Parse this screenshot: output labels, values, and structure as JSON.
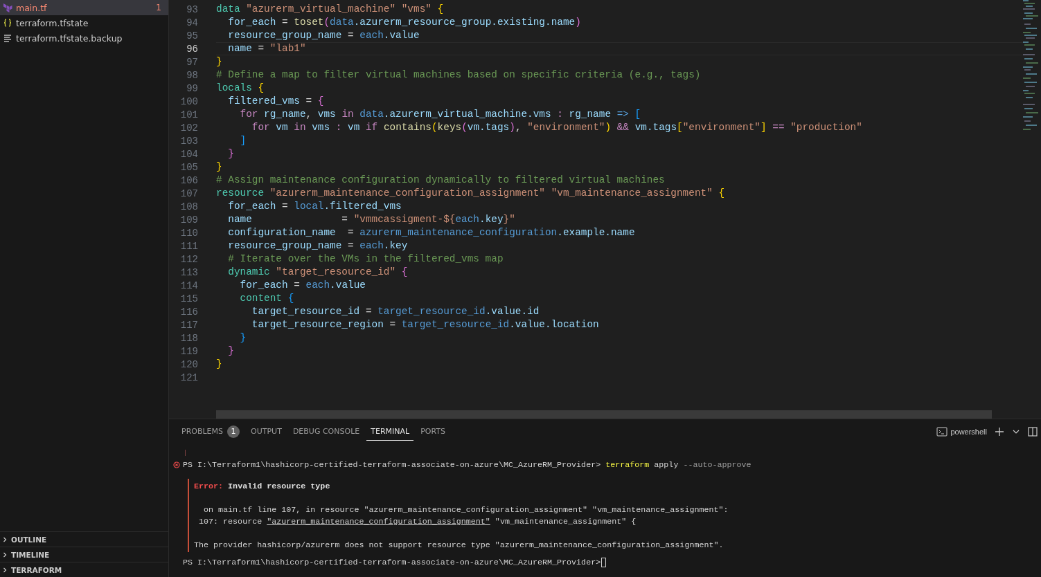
{
  "explorer": {
    "files": [
      {
        "name": "main.tf",
        "kind": "terraform",
        "selected": true,
        "error": true,
        "problems": "1"
      },
      {
        "name": "terraform.tfstate",
        "kind": "json",
        "selected": false,
        "error": false
      },
      {
        "name": "terraform.tfstate.backup",
        "kind": "text",
        "selected": false,
        "error": false
      }
    ],
    "sections": [
      {
        "title": "OUTLINE"
      },
      {
        "title": "TIMELINE"
      },
      {
        "title": "TERRAFORM"
      }
    ]
  },
  "editor": {
    "lines": [
      {
        "number": "93",
        "current": false,
        "tokens": [
          {
            "kind": "kw",
            "text": "data "
          },
          {
            "kind": "str",
            "text": "\"azurerm_virtual_machine\" "
          },
          {
            "kind": "str",
            "text": "\"vms\" "
          },
          {
            "kind": "b1",
            "text": "{"
          }
        ]
      },
      {
        "number": "94",
        "current": false,
        "tokens": [
          {
            "kind": "prop",
            "text": "  for_each"
          },
          {
            "kind": "p",
            "text": " = "
          },
          {
            "kind": "fn",
            "text": "toset"
          },
          {
            "kind": "b2",
            "text": "("
          },
          {
            "kind": "var",
            "text": "data"
          },
          {
            "kind": "prop",
            "text": ".azurerm_resource_group.existing.name"
          },
          {
            "kind": "b2",
            "text": ")"
          }
        ]
      },
      {
        "number": "95",
        "current": false,
        "tokens": [
          {
            "kind": "prop",
            "text": "  resource_group_name"
          },
          {
            "kind": "p",
            "text": " = "
          },
          {
            "kind": "var",
            "text": "each"
          },
          {
            "kind": "prop",
            "text": ".value"
          }
        ]
      },
      {
        "number": "96",
        "current": true,
        "tokens": [
          {
            "kind": "prop",
            "text": "  name"
          },
          {
            "kind": "p",
            "text": " = "
          },
          {
            "kind": "str",
            "text": "\"lab1\""
          }
        ]
      },
      {
        "number": "97",
        "current": false,
        "tokens": [
          {
            "kind": "b1",
            "text": "}"
          }
        ]
      },
      {
        "number": "98",
        "current": false,
        "tokens": [
          {
            "kind": "cm",
            "text": "# Define a map to filter virtual machines based on specific criteria (e.g., tags)"
          }
        ]
      },
      {
        "number": "99",
        "current": false,
        "tokens": [
          {
            "kind": "kw",
            "text": "locals "
          },
          {
            "kind": "b1",
            "text": "{"
          }
        ]
      },
      {
        "number": "100",
        "current": false,
        "tokens": [
          {
            "kind": "prop",
            "text": "  filtered_vms"
          },
          {
            "kind": "p",
            "text": " = "
          },
          {
            "kind": "b2",
            "text": "{"
          }
        ]
      },
      {
        "number": "101",
        "current": false,
        "tokens": [
          {
            "kind": "ctl",
            "text": "    for "
          },
          {
            "kind": "prop",
            "text": "rg_name"
          },
          {
            "kind": "p",
            "text": ", "
          },
          {
            "kind": "prop",
            "text": "vms "
          },
          {
            "kind": "ctl",
            "text": "in "
          },
          {
            "kind": "var",
            "text": "data"
          },
          {
            "kind": "prop",
            "text": ".azurerm_virtual_machine.vms "
          },
          {
            "kind": "ctl",
            "text": ": "
          },
          {
            "kind": "prop",
            "text": "rg_name "
          },
          {
            "kind": "var",
            "text": "=> "
          },
          {
            "kind": "b3",
            "text": "["
          }
        ]
      },
      {
        "number": "102",
        "current": false,
        "tokens": [
          {
            "kind": "ctl",
            "text": "      for "
          },
          {
            "kind": "prop",
            "text": "vm "
          },
          {
            "kind": "ctl",
            "text": "in "
          },
          {
            "kind": "prop",
            "text": "vms "
          },
          {
            "kind": "ctl",
            "text": ": "
          },
          {
            "kind": "prop",
            "text": "vm "
          },
          {
            "kind": "ctl",
            "text": "if "
          },
          {
            "kind": "fn",
            "text": "contains"
          },
          {
            "kind": "b1",
            "text": "("
          },
          {
            "kind": "fn",
            "text": "keys"
          },
          {
            "kind": "b2",
            "text": "("
          },
          {
            "kind": "prop",
            "text": "vm.tags"
          },
          {
            "kind": "b2",
            "text": ")"
          },
          {
            "kind": "p",
            "text": ", "
          },
          {
            "kind": "str",
            "text": "\"environment\""
          },
          {
            "kind": "b1",
            "text": ") "
          },
          {
            "kind": "ctl",
            "text": "&& "
          },
          {
            "kind": "prop",
            "text": "vm.tags"
          },
          {
            "kind": "b1",
            "text": "["
          },
          {
            "kind": "str",
            "text": "\"environment\""
          },
          {
            "kind": "b1",
            "text": "] "
          },
          {
            "kind": "ctl",
            "text": "== "
          },
          {
            "kind": "str",
            "text": "\"production\""
          }
        ]
      },
      {
        "number": "103",
        "current": false,
        "tokens": [
          {
            "kind": "b3",
            "text": "    ]"
          }
        ]
      },
      {
        "number": "104",
        "current": false,
        "tokens": [
          {
            "kind": "b2",
            "text": "  }"
          }
        ]
      },
      {
        "number": "105",
        "current": false,
        "tokens": [
          {
            "kind": "b1",
            "text": "}"
          }
        ]
      },
      {
        "number": "106",
        "current": false,
        "tokens": [
          {
            "kind": "cm",
            "text": "# Assign maintenance configuration dynamically to filtered virtual machines"
          }
        ]
      },
      {
        "number": "107",
        "current": false,
        "tokens": [
          {
            "kind": "kw",
            "text": "resource "
          },
          {
            "kind": "str",
            "text": "\"azurerm_maintenance_configuration_assignment\" "
          },
          {
            "kind": "str",
            "text": "\"vm_maintenance_assignment\" "
          },
          {
            "kind": "b1",
            "text": "{"
          }
        ]
      },
      {
        "number": "108",
        "current": false,
        "tokens": [
          {
            "kind": "prop",
            "text": "  for_each"
          },
          {
            "kind": "p",
            "text": " = "
          },
          {
            "kind": "var",
            "text": "local"
          },
          {
            "kind": "prop",
            "text": ".filtered_vms"
          }
        ]
      },
      {
        "number": "109",
        "current": false,
        "tokens": [
          {
            "kind": "prop",
            "text": "  name"
          },
          {
            "kind": "p",
            "text": "               = "
          },
          {
            "kind": "str",
            "text": "\"vmmcassigment-${"
          },
          {
            "kind": "var",
            "text": "each"
          },
          {
            "kind": "prop",
            "text": ".key"
          },
          {
            "kind": "str",
            "text": "}\""
          }
        ]
      },
      {
        "number": "110",
        "current": false,
        "tokens": [
          {
            "kind": "prop",
            "text": "  configuration_name"
          },
          {
            "kind": "p",
            "text": "  = "
          },
          {
            "kind": "var",
            "text": "azurerm_maintenance_configuration"
          },
          {
            "kind": "prop",
            "text": ".example.name"
          }
        ]
      },
      {
        "number": "111",
        "current": false,
        "tokens": [
          {
            "kind": "prop",
            "text": "  resource_group_name"
          },
          {
            "kind": "p",
            "text": " = "
          },
          {
            "kind": "var",
            "text": "each"
          },
          {
            "kind": "prop",
            "text": ".key"
          }
        ]
      },
      {
        "number": "112",
        "current": false,
        "tokens": [
          {
            "kind": "cm",
            "text": "  # Iterate over the VMs in the filtered_vms map"
          }
        ]
      },
      {
        "number": "113",
        "current": false,
        "tokens": [
          {
            "kind": "kw",
            "text": "  dynamic "
          },
          {
            "kind": "str",
            "text": "\"target_resource_id\" "
          },
          {
            "kind": "b2",
            "text": "{"
          }
        ]
      },
      {
        "number": "114",
        "current": false,
        "tokens": [
          {
            "kind": "prop",
            "text": "    for_each"
          },
          {
            "kind": "p",
            "text": " = "
          },
          {
            "kind": "var",
            "text": "each"
          },
          {
            "kind": "prop",
            "text": ".value"
          }
        ]
      },
      {
        "number": "115",
        "current": false,
        "tokens": [
          {
            "kind": "kw",
            "text": "    content "
          },
          {
            "kind": "b3",
            "text": "{"
          }
        ]
      },
      {
        "number": "116",
        "current": false,
        "tokens": [
          {
            "kind": "prop",
            "text": "      target_resource_id"
          },
          {
            "kind": "p",
            "text": " = "
          },
          {
            "kind": "var",
            "text": "target_resource_id"
          },
          {
            "kind": "prop",
            "text": ".value.id"
          }
        ]
      },
      {
        "number": "117",
        "current": false,
        "tokens": [
          {
            "kind": "prop",
            "text": "      target_resource_region"
          },
          {
            "kind": "p",
            "text": " = "
          },
          {
            "kind": "var",
            "text": "target_resource_id"
          },
          {
            "kind": "prop",
            "text": ".value.location"
          }
        ]
      },
      {
        "number": "118",
        "current": false,
        "tokens": [
          {
            "kind": "b3",
            "text": "    }"
          }
        ]
      },
      {
        "number": "119",
        "current": false,
        "tokens": [
          {
            "kind": "b2",
            "text": "  }"
          }
        ]
      },
      {
        "number": "120",
        "current": false,
        "tokens": [
          {
            "kind": "b1",
            "text": "}"
          }
        ]
      },
      {
        "number": "121",
        "current": false
      }
    ]
  },
  "panel": {
    "tabs": [
      {
        "label": "PROBLEMS",
        "selected": false,
        "count": "1"
      },
      {
        "label": "OUTPUT",
        "selected": false
      },
      {
        "label": "DEBUG CONSOLE",
        "selected": false
      },
      {
        "label": "TERMINAL",
        "selected": true
      },
      {
        "label": "PORTS",
        "selected": false
      }
    ],
    "shell": "powershell",
    "terminal": [
      {
        "kind": "marker"
      },
      {
        "kind": "prompt",
        "error": true,
        "tokens": [
          {
            "kind": "p",
            "text": "PS I:\\Terraform1\\hashicorp-certified-terraform-associate-on-azure\\MC_AzureRM_Provider> "
          },
          {
            "kind": "cmd",
            "text": "terraform"
          },
          {
            "kind": "p",
            "text": " apply "
          },
          {
            "kind": "arg",
            "text": "--auto-approve"
          }
        ]
      },
      {
        "kind": "error_block",
        "lines": [
          {
            "kind": "text",
            "tokens": [
              {
                "kind": "err",
                "text": "Error: "
              },
              {
                "kind": "b",
                "text": "Invalid resource type"
              }
            ]
          },
          {
            "kind": "blank"
          },
          {
            "kind": "text",
            "tokens": [
              {
                "kind": "p",
                "text": "  on main.tf line 107, in resource \"azurerm_maintenance_configuration_assignment\" \"vm_maintenance_assignment\":"
              }
            ]
          },
          {
            "kind": "text",
            "tokens": [
              {
                "kind": "p",
                "text": " 107: resource "
              },
              {
                "kind": "u",
                "text": "\"azurerm_maintenance_configuration_assignment\""
              },
              {
                "kind": "p",
                "text": " \"vm_maintenance_assignment\" {"
              }
            ]
          },
          {
            "kind": "blank"
          },
          {
            "kind": "text",
            "tokens": [
              {
                "kind": "p",
                "text": "The provider hashicorp/azurerm does not support resource type \"azurerm_maintenance_configuration_assignment\"."
              }
            ]
          }
        ]
      },
      {
        "kind": "prompt",
        "error": false,
        "cursor": true,
        "tokens": [
          {
            "kind": "p",
            "text": "PS I:\\Terraform1\\hashicorp-certified-terraform-associate-on-azure\\MC_AzureRM_Provider>"
          }
        ]
      }
    ]
  }
}
